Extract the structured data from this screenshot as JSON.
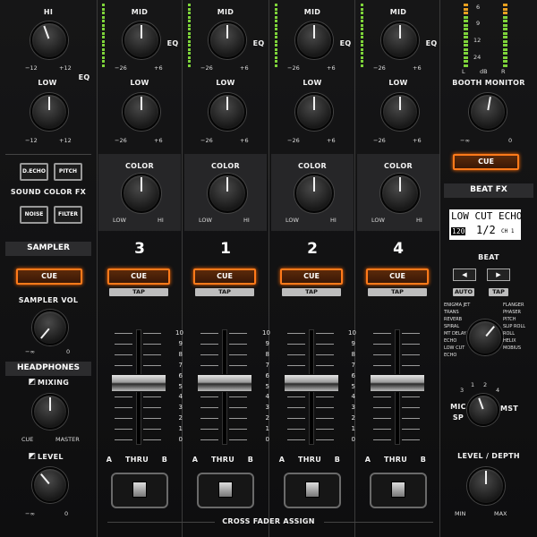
{
  "left": {
    "hi_label": "HI",
    "low_label": "LOW",
    "eq_label": "EQ",
    "scale_minus12": "−12",
    "scale_plus12": "+12",
    "echo_label": "D.ECHO",
    "pitch_label": "PITCH",
    "noise_label": "NOISE",
    "filter_label": "FILTER",
    "sound_color_fx": "SOUND COLOR FX",
    "sampler": "SAMPLER",
    "cue": "CUE",
    "sampler_vol": "SAMPLER VOL",
    "minus_inf": "−∞",
    "zero": "0",
    "headphones": "HEADPHONES",
    "mixing": "MIXING",
    "cue_small": "CUE",
    "master": "MASTER",
    "level": "LEVEL",
    "headphone_icon": "headphone-icon"
  },
  "channels": [
    {
      "number": "3",
      "mid": "MID",
      "low": "LOW",
      "eq": "EQ",
      "color": "COLOR",
      "low_small": "LOW",
      "hi_small": "HI",
      "m26": "−26",
      "p6": "+6",
      "cue": "CUE",
      "tap": "TAP",
      "a": "A",
      "thru": "THRU",
      "b": "B"
    },
    {
      "number": "1",
      "mid": "MID",
      "low": "LOW",
      "eq": "EQ",
      "color": "COLOR",
      "low_small": "LOW",
      "hi_small": "HI",
      "m26": "−26",
      "p6": "+6",
      "cue": "CUE",
      "tap": "TAP",
      "a": "A",
      "thru": "THRU",
      "b": "B"
    },
    {
      "number": "2",
      "mid": "MID",
      "low": "LOW",
      "eq": "EQ",
      "color": "COLOR",
      "low_small": "LOW",
      "hi_small": "HI",
      "m26": "−26",
      "p6": "+6",
      "cue": "CUE",
      "tap": "TAP",
      "a": "A",
      "thru": "THRU",
      "b": "B"
    },
    {
      "number": "4",
      "mid": "MID",
      "low": "LOW",
      "eq": "EQ",
      "color": "COLOR",
      "low_small": "LOW",
      "hi_small": "HI",
      "m26": "−26",
      "p6": "+6",
      "cue": "CUE",
      "tap": "TAP",
      "a": "A",
      "thru": "THRU",
      "b": "B"
    }
  ],
  "fader_scale": [
    "10",
    "9",
    "8",
    "7",
    "6",
    "5",
    "4",
    "3",
    "2",
    "1",
    "0"
  ],
  "cross_fader_assign": "CROSS FADER ASSIGN",
  "right": {
    "meter_scale": [
      "6",
      "9",
      "12",
      "24"
    ],
    "meter_l": "L",
    "meter_db": "dB",
    "meter_r": "R",
    "booth_monitor": "BOOTH MONITOR",
    "minus_inf": "−∞",
    "zero": "0",
    "cue": "CUE",
    "beat_fx": "BEAT FX",
    "lcd_effect": "LOW CUT ECHO",
    "lcd_bpm": "120",
    "lcd_beat": "1/2",
    "lcd_channel": "CH 1",
    "beat": "BEAT",
    "auto": "AUTO",
    "tap": "TAP",
    "fx_list_left": [
      "ENIGMA JET",
      "TRANS",
      "REVERB",
      "SPIRAL",
      "MT DELAY",
      "ECHO",
      "LOW CUT",
      "ECHO"
    ],
    "fx_list_right": [
      "FLANGER",
      "PHASER",
      "PITCH",
      "SLIP ROLL",
      "ROLL",
      "HELIX",
      "MOBIUS"
    ],
    "sel_1": "1",
    "sel_2": "2",
    "sel_3": "3",
    "sel_4": "4",
    "mic": "MIC",
    "sp": "SP",
    "mst": "MST",
    "level_depth": "LEVEL / DEPTH",
    "min": "MIN",
    "max": "MAX"
  },
  "colors": {
    "cue_orange": "#ff7a1a",
    "meter_green": "#7ed43a"
  }
}
